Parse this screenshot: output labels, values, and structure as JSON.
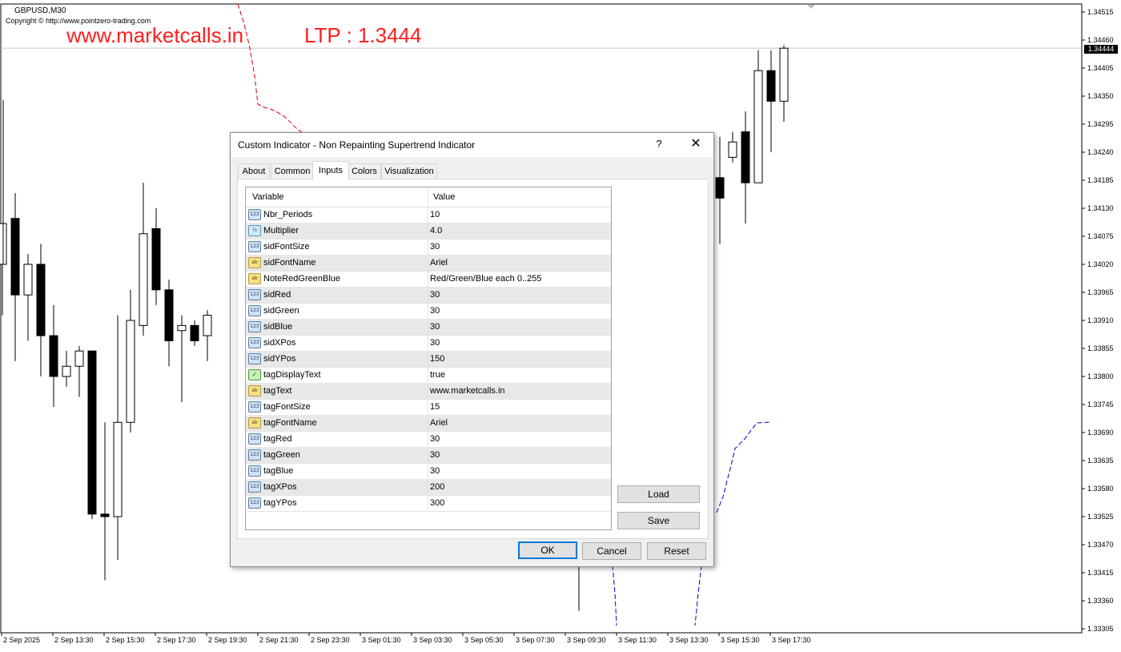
{
  "chart": {
    "symbol": "GBPUSD,M30",
    "copyright": "Copyright © http://www.pointzero-trading.com",
    "tag_text": "www.marketcalls.in",
    "ltp_text": "LTP : 1.3444",
    "current_price": "1.34444",
    "price_axis": [
      "1.34515",
      "1.34460",
      "1.34405",
      "1.34350",
      "1.34295",
      "1.34240",
      "1.34185",
      "1.34130",
      "1.34075",
      "1.34020",
      "1.33965",
      "1.33910",
      "1.33855",
      "1.33800",
      "1.33745",
      "1.33690",
      "1.33635",
      "1.33580",
      "1.33525",
      "1.33470",
      "1.33415",
      "1.33360",
      "1.33305"
    ],
    "time_axis": [
      "2 Sep 2025",
      "2 Sep 13:30",
      "2 Sep 15:30",
      "2 Sep 17:30",
      "2 Sep 19:30",
      "2 Sep 21:30",
      "2 Sep 23:30",
      "3 Sep 01:30",
      "3 Sep 03:30",
      "3 Sep 05:30",
      "3 Sep 07:30",
      "3 Sep 09:30",
      "3 Sep 11:30",
      "3 Sep 13:30",
      "3 Sep 15:30",
      "3 Sep 17:30"
    ],
    "colors": {
      "tag": "#ff1e1e",
      "supertrend_up": "#0000cc",
      "supertrend_down": "#dd0000"
    },
    "candles": [
      {
        "o": 1.3402,
        "h": 1.3407,
        "l": 1.3392,
        "c": 1.341
      },
      {
        "o": 1.3411,
        "h": 1.3416,
        "l": 1.3383,
        "c": 1.3396
      },
      {
        "o": 1.3396,
        "h": 1.3404,
        "l": 1.3387,
        "c": 1.3402
      },
      {
        "o": 1.3402,
        "h": 1.3406,
        "l": 1.338,
        "c": 1.3388
      },
      {
        "o": 1.3388,
        "h": 1.3394,
        "l": 1.3374,
        "c": 1.338
      },
      {
        "o": 1.338,
        "h": 1.3385,
        "l": 1.3378,
        "c": 1.3382
      },
      {
        "o": 1.3382,
        "h": 1.3386,
        "l": 1.3376,
        "c": 1.3385
      },
      {
        "o": 1.3385,
        "h": 1.3385,
        "l": 1.3352,
        "c": 1.3353
      },
      {
        "o": 1.3353,
        "h": 1.3371,
        "l": 1.334,
        "c": 1.33525
      },
      {
        "o": 1.33525,
        "h": 1.3392,
        "l": 1.3344,
        "c": 1.3371
      },
      {
        "o": 1.3371,
        "h": 1.3397,
        "l": 1.3369,
        "c": 1.3391
      },
      {
        "o": 1.339,
        "h": 1.3418,
        "l": 1.3388,
        "c": 1.3408
      },
      {
        "o": 1.3409,
        "h": 1.3413,
        "l": 1.3394,
        "c": 1.3397
      },
      {
        "o": 1.3397,
        "h": 1.3399,
        "l": 1.3382,
        "c": 1.3387
      },
      {
        "o": 1.3389,
        "h": 1.3392,
        "l": 1.3375,
        "c": 1.339
      },
      {
        "o": 1.339,
        "h": 1.3391,
        "l": 1.3386,
        "c": 1.3387
      },
      {
        "o": 1.3388,
        "h": 1.3393,
        "l": 1.3383,
        "c": 1.3392
      }
    ],
    "right_candles": [
      {
        "o": 1.3345,
        "h": 1.3343,
        "l": 1.3334,
        "c": 1.3343
      },
      {
        "o": 1.3419,
        "h": 1.3427,
        "l": 1.3406,
        "c": 1.3415
      },
      {
        "o": 1.3423,
        "h": 1.3428,
        "l": 1.3422,
        "c": 1.3426
      },
      {
        "o": 1.3428,
        "h": 1.3432,
        "l": 1.341,
        "c": 1.3418
      },
      {
        "o": 1.3418,
        "h": 1.3444,
        "l": 1.3418,
        "c": 1.344
      },
      {
        "o": 1.344,
        "h": 1.3444,
        "l": 1.3424,
        "c": 1.3434
      },
      {
        "o": 1.3434,
        "h": 1.3445,
        "l": 1.343,
        "c": 1.34444
      }
    ]
  },
  "dialog": {
    "title": "Custom Indicator - Non Repainting Supertrend Indicator",
    "help_label": "?",
    "close_label": "✕",
    "tabs": [
      "About",
      "Common",
      "Inputs",
      "Colors",
      "Visualization"
    ],
    "active_tab": "Inputs",
    "columns": {
      "variable": "Variable",
      "value": "Value"
    },
    "rows": [
      {
        "icon": "123",
        "type": "int",
        "name": "Nbr_Periods",
        "value": "10"
      },
      {
        "icon": "½",
        "type": "dbl",
        "name": "Multiplier",
        "value": "4.0"
      },
      {
        "icon": "123",
        "type": "int",
        "name": "sidFontSize",
        "value": "30"
      },
      {
        "icon": "ab",
        "type": "str",
        "name": "sidFontName",
        "value": "Ariel"
      },
      {
        "icon": "ab",
        "type": "str",
        "name": "NoteRedGreenBlue",
        "value": "Red/Green/Blue each 0..255"
      },
      {
        "icon": "123",
        "type": "int",
        "name": "sidRed",
        "value": "30"
      },
      {
        "icon": "123",
        "type": "int",
        "name": "sidGreen",
        "value": "30"
      },
      {
        "icon": "123",
        "type": "int",
        "name": "sidBlue",
        "value": "30"
      },
      {
        "icon": "123",
        "type": "int",
        "name": "sidXPos",
        "value": "30"
      },
      {
        "icon": "123",
        "type": "int",
        "name": "sidYPos",
        "value": "150"
      },
      {
        "icon": "✓",
        "type": "bool",
        "name": "tagDisplayText",
        "value": "true"
      },
      {
        "icon": "ab",
        "type": "str",
        "name": "tagText",
        "value": "www.marketcalls.in"
      },
      {
        "icon": "123",
        "type": "int",
        "name": "tagFontSize",
        "value": "15"
      },
      {
        "icon": "ab",
        "type": "str",
        "name": "tagFontName",
        "value": "Ariel"
      },
      {
        "icon": "123",
        "type": "int",
        "name": "tagRed",
        "value": "30"
      },
      {
        "icon": "123",
        "type": "int",
        "name": "tagGreen",
        "value": "30"
      },
      {
        "icon": "123",
        "type": "int",
        "name": "tagBlue",
        "value": "30"
      },
      {
        "icon": "123",
        "type": "int",
        "name": "tagXPos",
        "value": "200"
      },
      {
        "icon": "123",
        "type": "int",
        "name": "tagYPos",
        "value": "300"
      }
    ],
    "buttons": {
      "load": "Load",
      "save": "Save",
      "ok": "OK",
      "cancel": "Cancel",
      "reset": "Reset"
    }
  }
}
